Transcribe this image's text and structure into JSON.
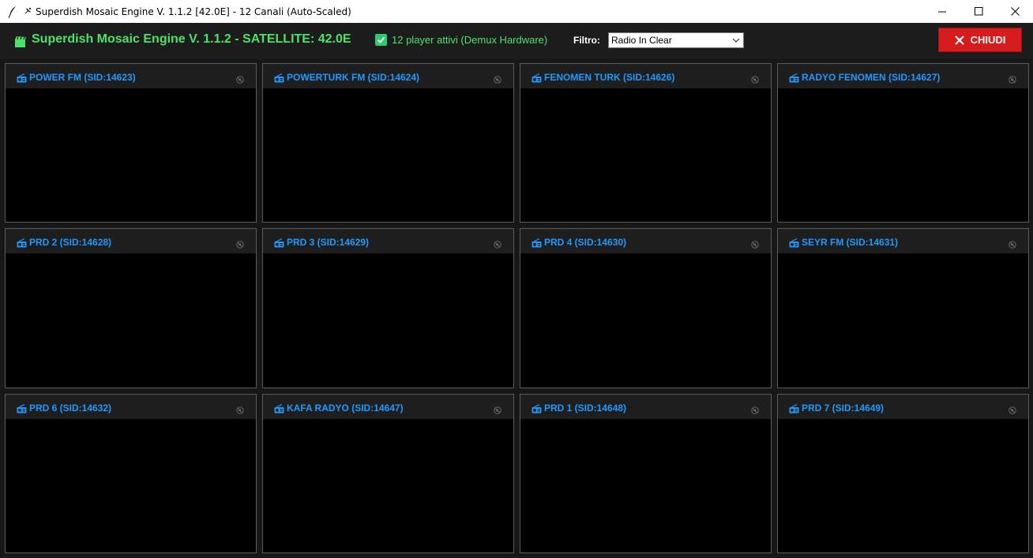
{
  "window": {
    "title": "Superdish Mosaic Engine V. 1.1.2 [42.0E] - 12 Canali (Auto-Scaled)",
    "title_icon": "satellite-icon",
    "app_icon": "feather-icon",
    "controls": [
      "minimize-icon",
      "maximize-icon",
      "close-icon"
    ]
  },
  "header": {
    "icon": "film-icon",
    "title": "Superdish Mosaic Engine V. 1.1.2 - SATELLITE: 42.0E",
    "status_text": "12 player attivi (Demux Hardware)",
    "filter_label": "Filtro:",
    "filter_value": "Radio In Clear",
    "close_label": "CHIUDI",
    "colors": {
      "accent_green": "#4ce26a",
      "channel_blue": "#1e9aff",
      "close_red": "#d61c1c"
    }
  },
  "channels": [
    {
      "name": "POWER FM (SID:14623)"
    },
    {
      "name": "POWERTURK FM (SID:14624)"
    },
    {
      "name": "FENOMEN TURK (SID:14626)"
    },
    {
      "name": "RADYO FENOMEN (SID:14627)"
    },
    {
      "name": "PRD 2 (SID:14628)"
    },
    {
      "name": "PRD 3 (SID:14629)"
    },
    {
      "name": "PRD 4 (SID:14630)"
    },
    {
      "name": "SEYR FM (SID:14631)"
    },
    {
      "name": "PRD 6 (SID:14632)"
    },
    {
      "name": "KAFA RADYO (SID:14647)"
    },
    {
      "name": "PRD 1 (SID:14648)"
    },
    {
      "name": "PRD 7 (SID:14649)"
    }
  ]
}
